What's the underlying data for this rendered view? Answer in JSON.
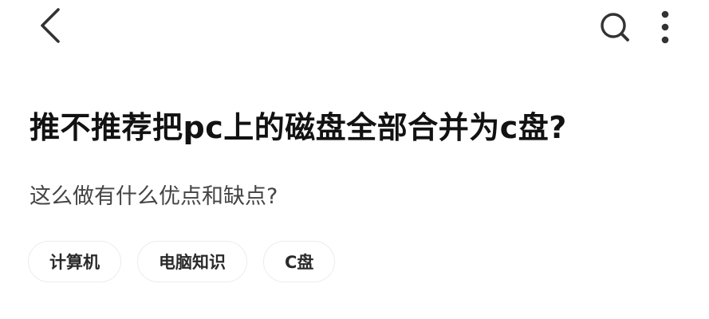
{
  "header": {
    "back_icon": "chevron-left-icon",
    "search_icon": "search-icon",
    "more_icon": "more-vertical-icon"
  },
  "question": {
    "title": "推不推荐把pc上的磁盘全部合并为c盘?",
    "description": "这么做有什么优点和缺点?"
  },
  "tags": [
    {
      "label": "计算机"
    },
    {
      "label": "电脑知识"
    },
    {
      "label": "C盘"
    }
  ],
  "colors": {
    "text_primary": "#121212",
    "text_secondary": "#444444",
    "tag_border": "#ececec",
    "icon": "#333333"
  }
}
